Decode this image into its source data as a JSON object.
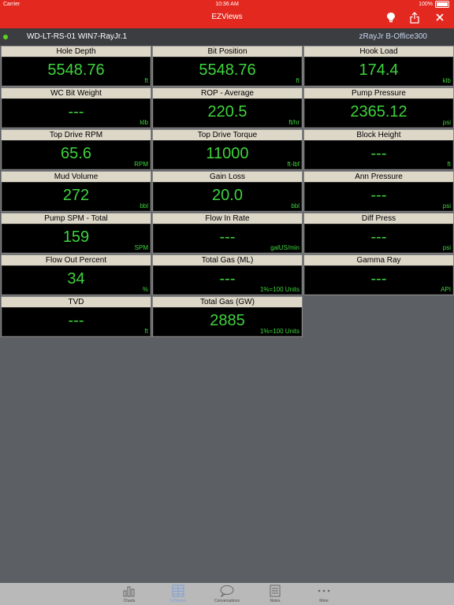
{
  "status_bar": {
    "carrier": "Carrier",
    "time": "10:36 AM",
    "battery": "100%"
  },
  "header": {
    "title": "EZViews",
    "icons": [
      "lightbulb-icon",
      "share-icon",
      "close-icon"
    ]
  },
  "connection": {
    "left": "WD-LT-RS-01 WIN7-RayJr.1",
    "right": "zRayJr B-Office300",
    "status_color": "#5ed31f"
  },
  "tiles": [
    {
      "label": "Hole Depth",
      "value": "5548.76",
      "unit": "ft"
    },
    {
      "label": "Bit Position",
      "value": "5548.76",
      "unit": "ft"
    },
    {
      "label": "Hook Load",
      "value": "174.4",
      "unit": "klb"
    },
    {
      "label": "WC Bit Weight",
      "value": "---",
      "unit": "klb"
    },
    {
      "label": "ROP - Average",
      "value": "220.5",
      "unit": "ft/hr"
    },
    {
      "label": "Pump Pressure",
      "value": "2365.12",
      "unit": "psi"
    },
    {
      "label": "Top Drive RPM",
      "value": "65.6",
      "unit": "RPM"
    },
    {
      "label": "Top Drive Torque",
      "value": "11000",
      "unit": "ft-lbf"
    },
    {
      "label": "Block Height",
      "value": "---",
      "unit": "ft"
    },
    {
      "label": "Mud Volume",
      "value": "272",
      "unit": "bbl"
    },
    {
      "label": "Gain Loss",
      "value": "20.0",
      "unit": "bbl"
    },
    {
      "label": "Ann Pressure",
      "value": "---",
      "unit": "psi"
    },
    {
      "label": "Pump SPM - Total",
      "value": "159",
      "unit": "SPM"
    },
    {
      "label": "Flow In Rate",
      "value": "---",
      "unit": "galUS/min"
    },
    {
      "label": "Diff Press",
      "value": "---",
      "unit": "psi"
    },
    {
      "label": "Flow Out Percent",
      "value": "34",
      "unit": "%"
    },
    {
      "label": "Total Gas (ML)",
      "value": "---",
      "unit": "1%=100 Units"
    },
    {
      "label": "Gamma Ray",
      "value": "---",
      "unit": "API"
    },
    {
      "label": "TVD",
      "value": "---",
      "unit": "ft"
    },
    {
      "label": "Total Gas (GW)",
      "value": "2885",
      "unit": "1%=100 Units"
    }
  ],
  "tabbar": {
    "items": [
      {
        "label": "Charts",
        "icon": "bar-chart-icon",
        "active": false
      },
      {
        "label": "EZViews",
        "icon": "grid-icon",
        "active": true
      },
      {
        "label": "Conversations",
        "icon": "speech-bubble-icon",
        "active": false
      },
      {
        "label": "Notes",
        "icon": "notes-icon",
        "active": false
      },
      {
        "label": "More",
        "icon": "more-dots-icon",
        "active": false
      }
    ]
  },
  "colors": {
    "header_red": "#e3281f",
    "value_green": "#3ed43c",
    "label_bg": "#ddd7c8",
    "active_tab": "#7fa0d8"
  }
}
